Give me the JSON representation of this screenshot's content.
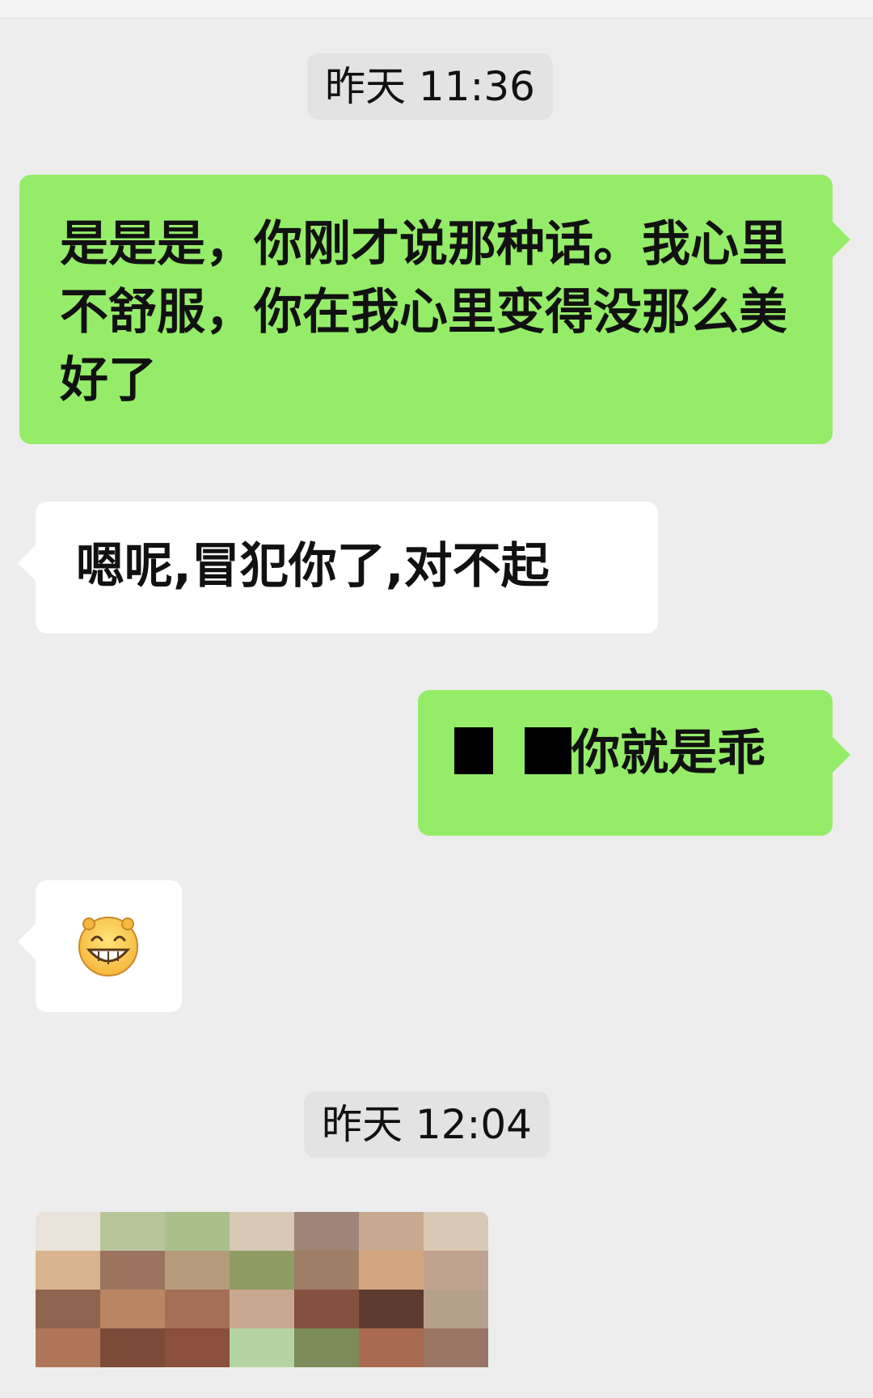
{
  "chat": {
    "timestamps": [
      "昨天 11:36",
      "昨天 12:04"
    ],
    "messages": [
      {
        "side": "out",
        "text": "是是是，你刚才说那种话。我心里不舒服，你在我心里变得没那么美好了"
      },
      {
        "side": "in",
        "text": "嗯呢,冒犯你了,对不起"
      },
      {
        "side": "out",
        "text": "你就是乖",
        "has_redaction": true
      },
      {
        "side": "in",
        "emoji_name": "grin-emoji"
      }
    ],
    "image_message": {
      "side": "in",
      "state": "pixelated",
      "tile_colors": [
        "#e9e3dc",
        "#b8c49a",
        "#a9c08c",
        "#d8c8b6",
        "#9e8577",
        "#c7a98f",
        "#d8c8b6",
        "#d7b48e",
        "#9b735f",
        "#b69a7c",
        "#8e9c63",
        "#9f7e68",
        "#d3a57f",
        "#bfa28f",
        "#8f654f",
        "#b98563",
        "#a46f56",
        "#c9a891",
        "#85513e",
        "#5d3b32",
        "#b5a08c",
        "#b0765a",
        "#7b4b38",
        "#8a4f3d",
        "#b5d4a3",
        "#7b8b5a",
        "#aa6a51",
        "#9a7464"
      ]
    }
  }
}
